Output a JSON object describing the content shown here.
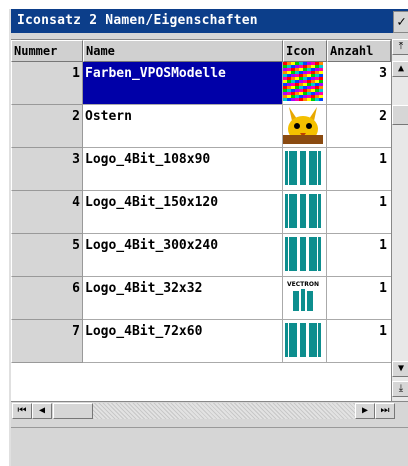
{
  "window": {
    "title": "Iconsatz 2 Namen/Eigenschaften",
    "check_icon": "checkmark-icon"
  },
  "table": {
    "columns": [
      "Nummer",
      "Name",
      "Icon",
      "Anzahl"
    ],
    "rows": [
      {
        "num": "1",
        "name": "Farben_VPOSModelle",
        "icon": "color-palette-icon",
        "anzahl": "3",
        "selected": true
      },
      {
        "num": "2",
        "name": "Ostern",
        "icon": "easter-bunny-icon",
        "anzahl": "2",
        "selected": false
      },
      {
        "num": "3",
        "name": "Logo_4Bit_108x90",
        "icon": "vectron-logo-icon",
        "anzahl": "1",
        "selected": false
      },
      {
        "num": "4",
        "name": "Logo_4Bit_150x120",
        "icon": "vectron-logo-icon",
        "anzahl": "1",
        "selected": false
      },
      {
        "num": "5",
        "name": "Logo_4Bit_300x240",
        "icon": "vectron-logo-icon",
        "anzahl": "1",
        "selected": false
      },
      {
        "num": "6",
        "name": "Logo_4Bit_32x32",
        "icon": "vectron-logo-text-icon",
        "anzahl": "1",
        "selected": false
      },
      {
        "num": "7",
        "name": "Logo_4Bit_72x60",
        "icon": "vectron-logo-icon",
        "anzahl": "1",
        "selected": false
      }
    ],
    "icon_logo_text": "VECTRON"
  },
  "scroll": {
    "up_top_icon": "scroll-to-top-icon",
    "up_icon": "arrow-up-icon",
    "down_icon": "arrow-down-icon",
    "down_bottom_icon": "scroll-to-bottom-icon",
    "first_icon": "scroll-first-icon",
    "left_icon": "arrow-left-icon",
    "right_icon": "arrow-right-icon",
    "last_icon": "scroll-last-icon"
  },
  "colors": {
    "titlebar": "#0c3e8a",
    "selection": "#0000a8",
    "logo_teal": "#0d8e8e"
  }
}
